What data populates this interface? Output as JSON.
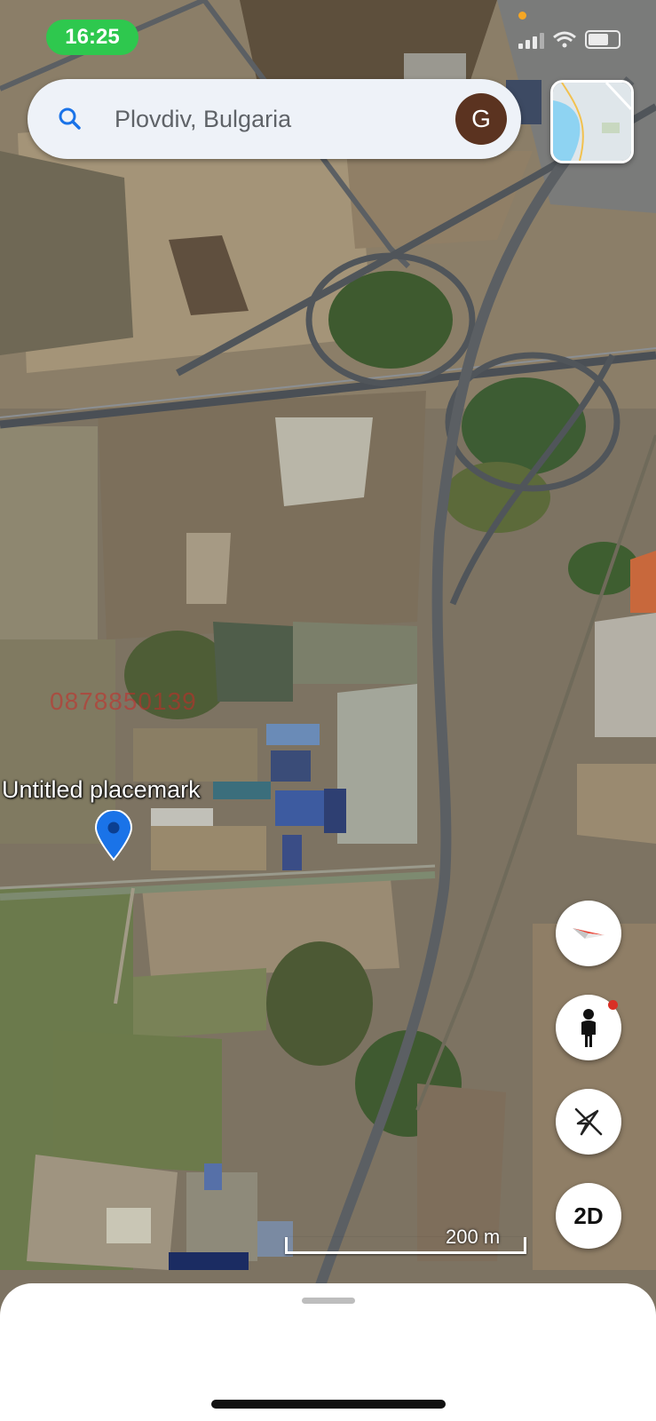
{
  "status_bar": {
    "time": "16:25"
  },
  "search": {
    "placeholder": "Plovdiv, Bulgaria",
    "avatar_initial": "G"
  },
  "placemark": {
    "label": "Untitled placemark"
  },
  "watermark": {
    "text": "0878850139"
  },
  "controls": {
    "view_mode_label": "2D"
  },
  "scale": {
    "label": "200 m"
  },
  "colors": {
    "accent_blue": "#1a73e8",
    "status_green": "#2ec84e",
    "avatar_brown": "#5b3320",
    "compass_red": "#ea4335"
  },
  "icons": {
    "search": "search-icon",
    "compass": "compass-icon",
    "pegman": "pegman-icon",
    "location": "location-off-icon",
    "layers": "map-layers-thumbnail"
  }
}
